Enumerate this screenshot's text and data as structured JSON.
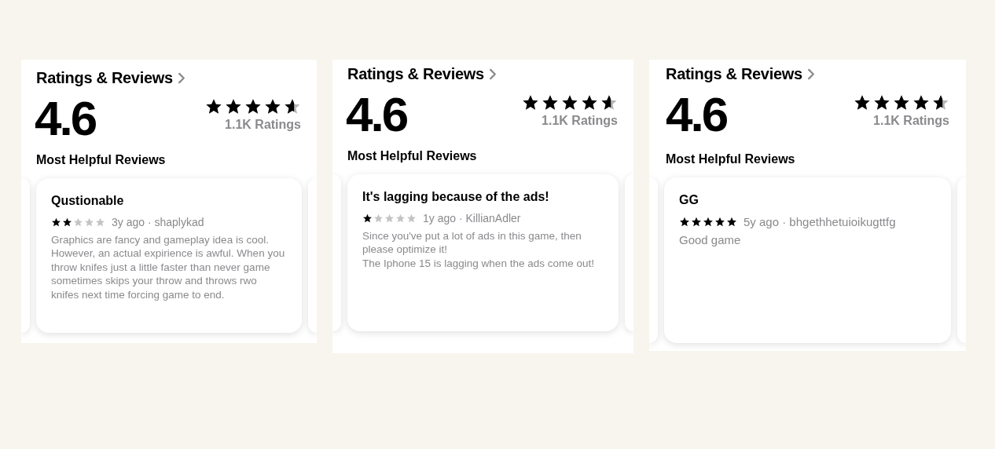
{
  "panels": [
    {
      "title": "Ratings & Reviews",
      "average": "4.6",
      "stars": 4.6,
      "ratings_count": "1.1K Ratings",
      "section_heading": "Most Helpful Reviews",
      "review": {
        "title": "Qustionable",
        "stars": 2,
        "meta": "3y ago · shaplykad",
        "body": "Graphics are fancy and gameplay idea is cool. However, an actual expirience is awful. When you throw knifes just a little faster than never game sometimes skips your throw and throws rwo knifes next time forcing game to end."
      }
    },
    {
      "title": "Ratings & Reviews",
      "average": "4.6",
      "stars": 4.6,
      "ratings_count": "1.1K Ratings",
      "section_heading": "Most Helpful Reviews",
      "review": {
        "title": "It's lagging because of the ads!",
        "stars": 1,
        "meta": "1y ago · KillianAdler",
        "body": "Since you've put a lot of ads in this game, then please optimize it!\nThe Iphone 15 is lagging when the ads come out!"
      }
    },
    {
      "title": "Ratings & Reviews",
      "average": "4.6",
      "stars": 4.6,
      "ratings_count": "1.1K Ratings",
      "section_heading": "Most Helpful Reviews",
      "review": {
        "title": "GG",
        "stars": 5,
        "meta": "5y ago · bhgethhetuioikugttfg",
        "body": "Good game"
      }
    }
  ]
}
